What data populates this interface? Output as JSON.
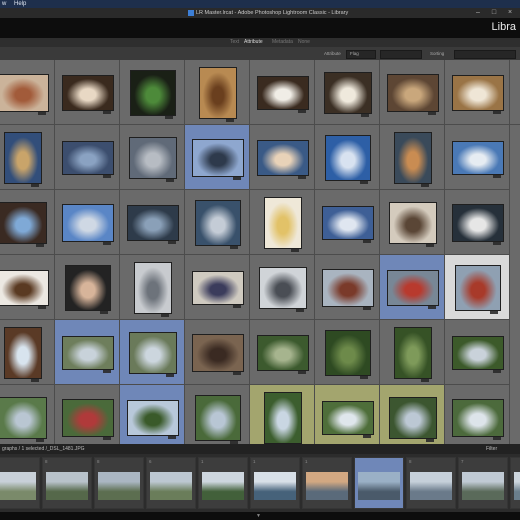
{
  "menubar": {
    "items": [
      "w",
      "Help"
    ]
  },
  "window": {
    "title": "LR Master.lrcat - Adobe Photoshop Lightroom Classic - Library",
    "controls": [
      "minimize",
      "maximize",
      "close"
    ]
  },
  "module": {
    "name": "Libra"
  },
  "filter_bar": {
    "items": [
      "Text",
      "Attribute",
      "Metadata",
      "None"
    ],
    "active": "Attribute"
  },
  "grid_toolbar": {
    "attribute_label": "Attribute",
    "flag_label": "Flag",
    "sort_label": "Sorting"
  },
  "filmstrip": {
    "status": "graphs / 1 selected /_DSL_1481.JPG",
    "filter_label": "Filter"
  },
  "colors": {
    "accent_blue": "#6f87b8",
    "green_label": "#a3a56e",
    "bg_gray": "#6a6a6a"
  },
  "grid_cells": [
    {
      "r": 0,
      "c": 0,
      "sel": "n",
      "t": "#cbb39a",
      "i": "#a25b3a"
    },
    {
      "r": 0,
      "c": 1,
      "sel": "n",
      "t": "#3a2a1e",
      "i": "#e8d8c4"
    },
    {
      "r": 0,
      "c": 2,
      "sel": "n",
      "t": "#1a2016",
      "i": "#4d8a3a"
    },
    {
      "r": 0,
      "c": 3,
      "sel": "n",
      "t": "#b88a52",
      "i": "#6a3f1e"
    },
    {
      "r": 0,
      "c": 4,
      "sel": "n",
      "t": "#3a2b20",
      "i": "#f0ede6"
    },
    {
      "r": 0,
      "c": 5,
      "sel": "n",
      "t": "#3b2f24",
      "i": "#efe9dc"
    },
    {
      "r": 0,
      "c": 6,
      "sel": "n",
      "t": "#5d4634",
      "i": "#c9a77c"
    },
    {
      "r": 0,
      "c": 7,
      "sel": "n",
      "t": "#9a7446",
      "i": "#efe6d6"
    },
    {
      "r": 0,
      "c": 8,
      "sel": "n",
      "t": "#8e97a3",
      "i": "#c4b8a6"
    },
    {
      "r": 1,
      "c": 0,
      "sel": "n",
      "t": "#324e7a",
      "i": "#c9a46a"
    },
    {
      "r": 1,
      "c": 1,
      "sel": "n",
      "t": "#3c4e6e",
      "i": "#8aa2c2"
    },
    {
      "r": 1,
      "c": 2,
      "sel": "n",
      "t": "#606a78",
      "i": "#b7bcc3"
    },
    {
      "r": 1,
      "c": 3,
      "sel": "b",
      "t": "#8ea7cf",
      "i": "#2e3a4c"
    },
    {
      "r": 1,
      "c": 4,
      "sel": "n",
      "t": "#3a5a86",
      "i": "#e8d2b8"
    },
    {
      "r": 1,
      "c": 5,
      "sel": "n",
      "t": "#2d5fa6",
      "i": "#d8e2f0"
    },
    {
      "r": 1,
      "c": 6,
      "sel": "n",
      "t": "#3a4a5a",
      "i": "#c98c52"
    },
    {
      "r": 1,
      "c": 7,
      "sel": "n",
      "t": "#4a79b6",
      "i": "#e6ecf2"
    },
    {
      "r": 2,
      "c": 0,
      "sel": "n",
      "t": "#3a2a22",
      "i": "#7fa9d6"
    },
    {
      "r": 2,
      "c": 1,
      "sel": "n",
      "t": "#5a86c6",
      "i": "#cfd8e4"
    },
    {
      "r": 2,
      "c": 2,
      "sel": "n",
      "t": "#2e3b4a",
      "i": "#8aa0b8"
    },
    {
      "r": 2,
      "c": 3,
      "sel": "n",
      "t": "#39516b",
      "i": "#c4ccd6"
    },
    {
      "r": 2,
      "c": 4,
      "sel": "n",
      "t": "#efe8d8",
      "i": "#e2c268"
    },
    {
      "r": 2,
      "c": 5,
      "sel": "n",
      "t": "#3e5f96",
      "i": "#dfe6f0"
    },
    {
      "r": 2,
      "c": 6,
      "sel": "n",
      "t": "#d4cbbd",
      "i": "#5a4636"
    },
    {
      "r": 2,
      "c": 7,
      "sel": "n",
      "t": "#26303a",
      "i": "#e6e6e6"
    },
    {
      "r": 3,
      "c": 0,
      "sel": "n",
      "t": "#ece8e2",
      "i": "#5a3a22"
    },
    {
      "r": 3,
      "c": 1,
      "sel": "n",
      "t": "#232323",
      "i": "#d7b49a"
    },
    {
      "r": 3,
      "c": 2,
      "sel": "n",
      "t": "#c8cbcf",
      "i": "#6d737b"
    },
    {
      "r": 3,
      "c": 3,
      "sel": "n",
      "t": "#cfcac0",
      "i": "#3b3c5c"
    },
    {
      "r": 3,
      "c": 4,
      "sel": "n",
      "t": "#d0d4d8",
      "i": "#4a4e55"
    },
    {
      "r": 3,
      "c": 5,
      "sel": "n",
      "t": "#a9b4c0",
      "i": "#7a3a2a"
    },
    {
      "r": 3,
      "c": 6,
      "sel": "b",
      "t": "#788796",
      "i": "#b83a2e"
    },
    {
      "r": 3,
      "c": 7,
      "sel": "w",
      "t": "#8fa0b2",
      "i": "#a83a2a"
    },
    {
      "r": 4,
      "c": 0,
      "sel": "n",
      "t": "#5a3a26",
      "i": "#d8e4ee"
    },
    {
      "r": 4,
      "c": 1,
      "sel": "b",
      "t": "#6e7e5c",
      "i": "#c8d2da"
    },
    {
      "r": 4,
      "c": 2,
      "sel": "b",
      "t": "#6a7a5a",
      "i": "#ccd6de"
    },
    {
      "r": 4,
      "c": 3,
      "sel": "n",
      "t": "#7a6450",
      "i": "#3a2a22"
    },
    {
      "r": 4,
      "c": 4,
      "sel": "n",
      "t": "#3c5a2e",
      "i": "#a6b48e"
    },
    {
      "r": 4,
      "c": 5,
      "sel": "n",
      "t": "#2e4a22",
      "i": "#6d8a4a"
    },
    {
      "r": 4,
      "c": 6,
      "sel": "n",
      "t": "#365226",
      "i": "#7e9a5a"
    },
    {
      "r": 4,
      "c": 7,
      "sel": "n",
      "t": "#3c5a2a",
      "i": "#c9d2da"
    },
    {
      "r": 5,
      "c": 0,
      "sel": "n",
      "t": "#5a7a4a",
      "i": "#b9c6d2"
    },
    {
      "r": 5,
      "c": 1,
      "sel": "n",
      "t": "#4a6a3a",
      "i": "#b03a3a"
    },
    {
      "r": 5,
      "c": 2,
      "sel": "b",
      "t": "#b8c8da",
      "i": "#3a5a2a"
    },
    {
      "r": 5,
      "c": 3,
      "sel": "n",
      "t": "#4a6a3a",
      "i": "#b8c6d4"
    },
    {
      "r": 5,
      "c": 4,
      "sel": "g",
      "t": "#3c5e2e",
      "i": "#c9d6e2"
    },
    {
      "r": 5,
      "c": 5,
      "sel": "g",
      "t": "#4e6e3a",
      "i": "#dfe6ec"
    },
    {
      "r": 5,
      "c": 6,
      "sel": "g",
      "t": "#3c5630",
      "i": "#bcc8d4"
    },
    {
      "r": 5,
      "c": 7,
      "sel": "n",
      "t": "#4c6a3c",
      "i": "#dde4ea"
    }
  ],
  "film_cells": [
    {
      "n": "",
      "t": "#7a8a6a",
      "i": "#c8d0d8",
      "sel": "n"
    },
    {
      "n": "8",
      "t": "#55684a",
      "i": "#b8c2ca",
      "sel": "n"
    },
    {
      "n": "8",
      "t": "#5c6e50",
      "i": "#aab6c2",
      "sel": "n"
    },
    {
      "n": "6",
      "t": "#6a7d5a",
      "i": "#bcc7d1",
      "sel": "n"
    },
    {
      "n": "1",
      "t": "#42603a",
      "i": "#cdd6de",
      "sel": "n"
    },
    {
      "n": "1",
      "t": "#46627a",
      "i": "#d8e0e8",
      "sel": "n"
    },
    {
      "n": "1",
      "t": "#5a6a7a",
      "i": "#d2a882",
      "sel": "n"
    },
    {
      "n": "",
      "t": "#4a5a6a",
      "i": "#9ab0c6",
      "sel": "b"
    },
    {
      "n": "8",
      "t": "#6a7a8a",
      "i": "#c6d0da",
      "sel": "n"
    },
    {
      "n": "7",
      "t": "#5a6a5a",
      "i": "#c0cad4",
      "sel": "n"
    },
    {
      "n": "",
      "t": "#6a7e8c",
      "i": "#cdd6de",
      "sel": "n"
    }
  ]
}
